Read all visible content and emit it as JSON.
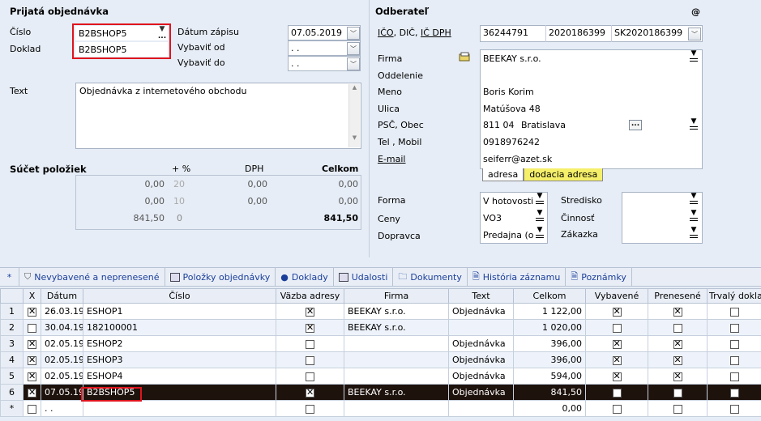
{
  "order": {
    "title": "Prijatá objednávka",
    "cislo_label": "Číslo",
    "cislo_value": "B2BSHOP5",
    "doklad_label": "Doklad",
    "doklad_value": "B2BSHOP5",
    "datum_zapisu_label": "Dátum zápisu",
    "datum_zapisu_value": "07.05.2019",
    "vybavit_od_label": "Vybaviť od",
    "vybavit_od_value": " .  .",
    "vybavit_do_label": "Vybaviť do",
    "vybavit_do_value": " .  .",
    "text_label": "Text",
    "text_value": "Objednávka z internetového obchodu"
  },
  "sum": {
    "title": "Súčet položiek",
    "col_pct": "+ %",
    "col_dph": "DPH",
    "col_celkom": "Celkom",
    "rows": [
      {
        "base": "0,00",
        "pct": "20",
        "dph": "0,00",
        "total": "0,00"
      },
      {
        "base": "0,00",
        "pct": "10",
        "dph": "0,00",
        "total": "0,00"
      },
      {
        "base": "841,50",
        "pct": "0",
        "dph": "",
        "total": "841,50"
      }
    ]
  },
  "customer": {
    "title": "Odberateľ",
    "at": "@",
    "ico_label": "IČO",
    "dic_label": "DIČ",
    "icdph_label": "IČ DPH",
    "ico": "36244791",
    "dic": "2020186399",
    "icdph": "SK2020186399",
    "firma_label": "Firma",
    "firma": "BEEKAY s.r.o.",
    "oddelenie_label": "Oddelenie",
    "meno_label": "Meno",
    "meno": "Boris Korim",
    "ulica_label": "Ulica",
    "ulica": "Matúšova 48",
    "psc_label": "PSČ, Obec",
    "psc": "811 04",
    "obec": "Bratislava",
    "tel_label": "Tel , Mobil",
    "tel": "0918976242",
    "email_label": "E-mail",
    "email": "seiferr@azet.sk",
    "tab_adresa": "adresa",
    "tab_dodacia": "dodacia adresa",
    "forma_label": "Forma",
    "forma": "V hotovosti",
    "ceny_label": "Ceny",
    "ceny": "VO3",
    "dopravca_label": "Dopravca",
    "dopravca": "Predajna (o",
    "stredisko_label": "Stredisko",
    "cinnost_label": "Činnosť",
    "zakazka_label": "Zákazka"
  },
  "tabs": [
    {
      "label": "Nevybavené a neprenesené"
    },
    {
      "label": "Položky objednávky"
    },
    {
      "label": "Doklady"
    },
    {
      "label": "Udalosti"
    },
    {
      "label": "Dokumenty"
    },
    {
      "label": "História záznamu"
    },
    {
      "label": "Poznámky"
    }
  ],
  "tabs_star": "*",
  "grid": {
    "headers": [
      "",
      "X",
      "Dátum",
      "Číslo",
      "Väzba adresy",
      "Firma",
      "Text",
      "Celkom",
      "Vybavené",
      "Prenesené",
      "Trvalý dokla"
    ],
    "rows": [
      {
        "n": "1",
        "x": true,
        "date": "26.03.19",
        "cislo": "ESHOP1",
        "vazba": true,
        "firma": "BEEKAY s.r.o.",
        "text": "Objednávka",
        "celkom": "1 122,00",
        "vyb": true,
        "pren": true,
        "trv": false
      },
      {
        "n": "2",
        "x": false,
        "date": "30.04.19",
        "cislo": "182100001",
        "vazba": true,
        "firma": "BEEKAY s.r.o.",
        "text": "",
        "celkom": "1 020,00",
        "vyb": false,
        "pren": false,
        "trv": false
      },
      {
        "n": "3",
        "x": true,
        "date": "02.05.19",
        "cislo": "ESHOP2",
        "vazba": false,
        "firma": "",
        "text": "Objednávka",
        "celkom": "396,00",
        "vyb": true,
        "pren": true,
        "trv": false
      },
      {
        "n": "4",
        "x": true,
        "date": "02.05.19",
        "cislo": "ESHOP3",
        "vazba": false,
        "firma": "",
        "text": "Objednávka",
        "celkom": "396,00",
        "vyb": true,
        "pren": true,
        "trv": false
      },
      {
        "n": "5",
        "x": true,
        "date": "02.05.19",
        "cislo": "ESHOP4",
        "vazba": false,
        "firma": "",
        "text": "Objednávka",
        "celkom": "594,00",
        "vyb": true,
        "pren": true,
        "trv": false
      },
      {
        "n": "6",
        "x": true,
        "date": "07.05.19",
        "cislo": "B2BSHOP5",
        "vazba": true,
        "firma": "BEEKAY s.r.o.",
        "text": "Objednávka",
        "celkom": "841,50",
        "vyb": false,
        "pren": false,
        "trv": false
      },
      {
        "n": "*",
        "x": false,
        "date": " . .",
        "cislo": "",
        "vazba": false,
        "firma": "",
        "text": "",
        "celkom": "0,00",
        "vyb": false,
        "pren": false,
        "trv": false
      }
    ]
  }
}
